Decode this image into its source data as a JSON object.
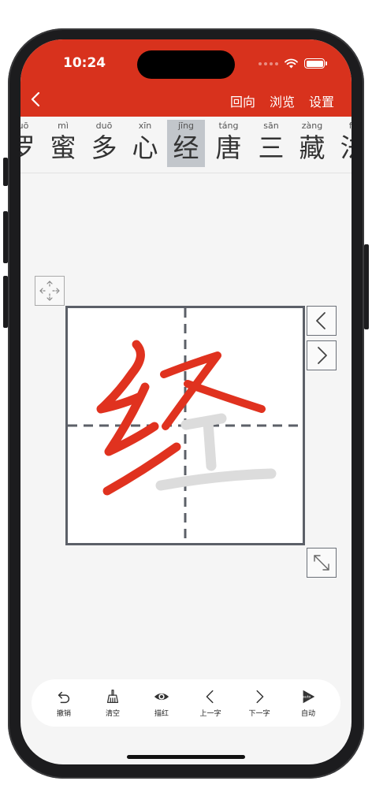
{
  "status_bar": {
    "time": "10:24"
  },
  "nav": {
    "actions": [
      "回向",
      "浏览",
      "设置"
    ]
  },
  "characters": [
    {
      "pinyin": "luō",
      "hanzi": "罗",
      "selected": false
    },
    {
      "pinyin": "mì",
      "hanzi": "蜜",
      "selected": false
    },
    {
      "pinyin": "duō",
      "hanzi": "多",
      "selected": false
    },
    {
      "pinyin": "xīn",
      "hanzi": "心",
      "selected": false
    },
    {
      "pinyin": "jīng",
      "hanzi": "经",
      "selected": true
    },
    {
      "pinyin": "táng",
      "hanzi": "唐",
      "selected": false
    },
    {
      "pinyin": "sān",
      "hanzi": "三",
      "selected": false
    },
    {
      "pinyin": "zàng",
      "hanzi": "藏",
      "selected": false
    },
    {
      "pinyin": "fǎ",
      "hanzi": "法",
      "selected": false
    }
  ],
  "writing": {
    "current_char": "经",
    "stroke_color": "#e0321f",
    "guide_color": "#dddddd"
  },
  "toolbar": {
    "undo": "撤销",
    "clear": "清空",
    "trace": "描红",
    "prev_char": "上一字",
    "next_char": "下一字",
    "auto": "自动",
    "auto_badge": "auto"
  },
  "colors": {
    "header": "#d8321d",
    "selected_char_bg": "#c2c6cb",
    "grid_border": "#5c6068"
  }
}
